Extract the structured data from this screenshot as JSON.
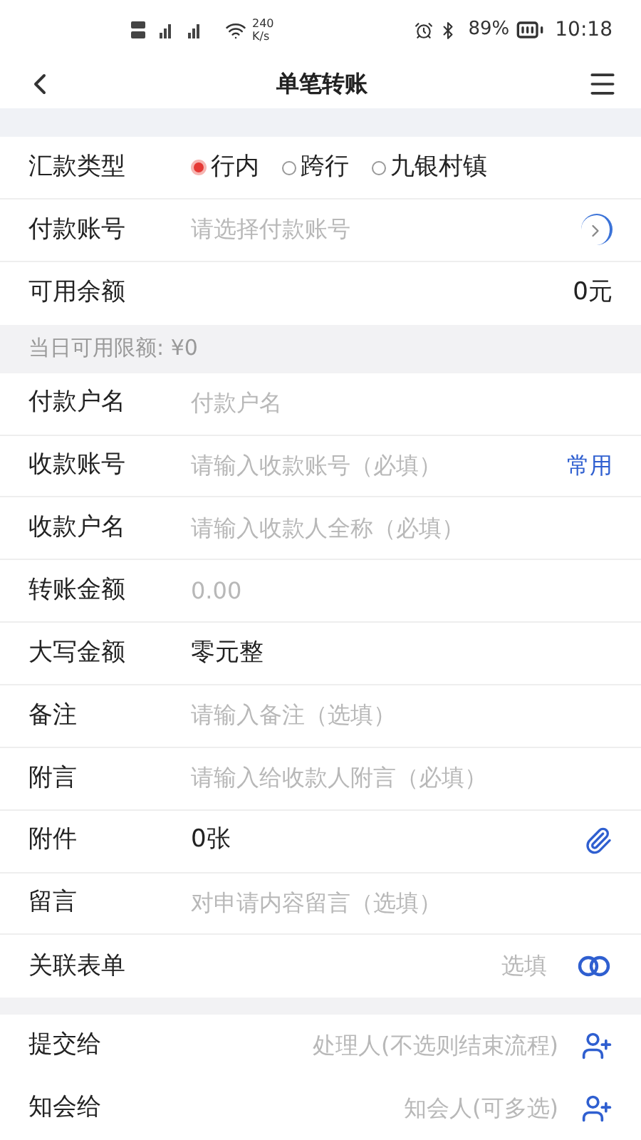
{
  "status_bar": {
    "speed": "240",
    "speed_unit": "K/s",
    "battery": "89%",
    "time": "10:18"
  },
  "header": {
    "title": "单笔转账"
  },
  "remit_type": {
    "label": "汇款类型",
    "options": [
      {
        "label": "行内",
        "selected": true
      },
      {
        "label": "跨行",
        "selected": false
      },
      {
        "label": "九银村镇",
        "selected": false
      }
    ]
  },
  "account_rows": [
    {
      "kind": "select",
      "label": "付款账号",
      "placeholder": "请选择付款账号"
    },
    {
      "kind": "balance",
      "label": "可用余额",
      "value": "0元"
    }
  ],
  "limit_notice": "当日可用限额: ¥0",
  "form_rows": [
    {
      "kind": "input",
      "label": "付款户名",
      "placeholder": "付款户名"
    },
    {
      "kind": "input_action",
      "label": "收款账号",
      "placeholder": "请输入收款账号（必填）",
      "action": "常用"
    },
    {
      "kind": "input",
      "label": "收款户名",
      "placeholder": "请输入收款人全称（必填）"
    },
    {
      "kind": "input",
      "label": "转账金额",
      "placeholder": "0.00"
    },
    {
      "kind": "text",
      "label": "大写金额",
      "value": "零元整"
    },
    {
      "kind": "input",
      "label": "备注",
      "placeholder": "请输入备注（选填）"
    },
    {
      "kind": "input",
      "label": "附言",
      "placeholder": "请输入给收款人附言（必填）"
    },
    {
      "kind": "attachment",
      "label": "附件",
      "value": "0张"
    },
    {
      "kind": "input",
      "label": "留言",
      "placeholder": "对申请内容留言（选填）"
    },
    {
      "kind": "link",
      "label": "关联表单",
      "placeholder": "选填"
    }
  ],
  "flow_rows": [
    {
      "kind": "assignee",
      "label": "提交给",
      "placeholder": "处理人(不选则结束流程)"
    },
    {
      "kind": "assignee",
      "label": "知会给",
      "placeholder": "知会人(可多选)"
    }
  ]
}
